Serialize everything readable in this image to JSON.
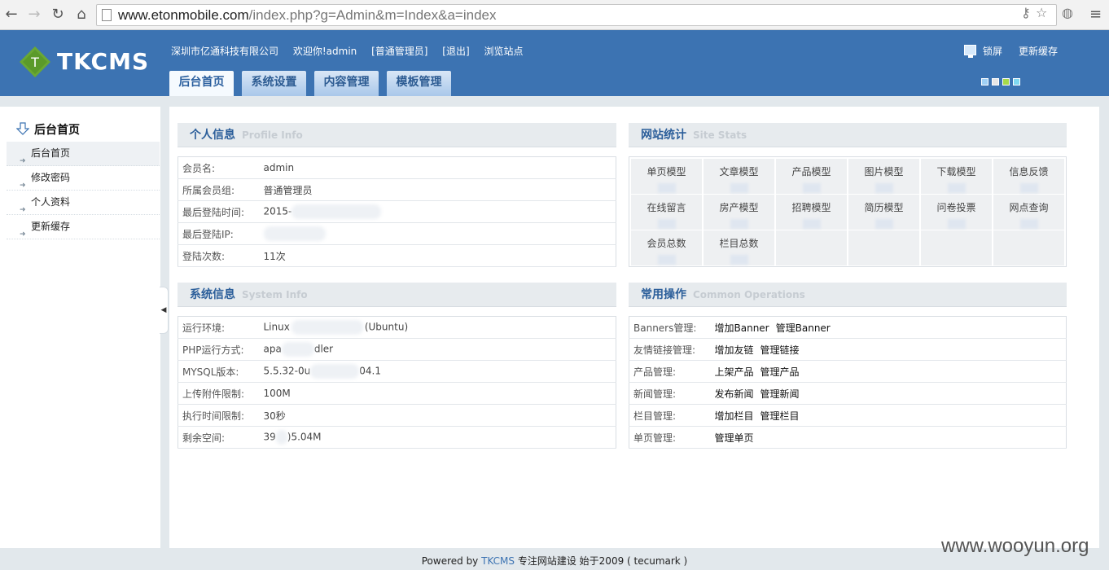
{
  "browser": {
    "url_host": "www.etonmobile.com",
    "url_path": "/index.php?g=Admin&m=Index&a=index"
  },
  "header": {
    "logo_text": "TKCMS",
    "company": "深圳市亿通科技有限公司",
    "welcome": "欢迎你!",
    "username": "admin",
    "role": "[普通管理员]",
    "logout": "[退出]",
    "browse_site": "浏览站点",
    "lock_screen": "锁屏",
    "refresh_cache": "更新缓存",
    "tabs": [
      "后台首页",
      "系统设置",
      "内容管理",
      "模板管理"
    ],
    "skin_colors": [
      "#9fd0f5",
      "#e6e6e6",
      "#a5d94a",
      "#7fd8f0"
    ]
  },
  "sidebar": {
    "title": "后台首页",
    "items": [
      "后台首页",
      "修改密码",
      "个人资料",
      "更新缓存"
    ]
  },
  "profile": {
    "title": "个人信息",
    "title_en": "Profile  Info",
    "rows": [
      {
        "k": "会员名:",
        "v": "admin"
      },
      {
        "k": "所属会员组:",
        "v": "普通管理员"
      },
      {
        "k": "最后登陆时间:",
        "v": "2015-"
      },
      {
        "k": "最后登陆IP:",
        "v": ""
      },
      {
        "k": "登陆次数:",
        "v": "11次"
      }
    ]
  },
  "site_stats": {
    "title": "网站统计",
    "title_en": "Site  Stats",
    "items": [
      "单页模型",
      "文章模型",
      "产品模型",
      "图片模型",
      "下载模型",
      "信息反馈",
      "在线留言",
      "房产模型",
      "招聘模型",
      "简历模型",
      "问卷投票",
      "网点查询",
      "会员总数",
      "栏目总数"
    ]
  },
  "system": {
    "title": "系统信息",
    "title_en": "System  Info",
    "rows": [
      {
        "k": "运行环境:",
        "v": "Linux",
        "v2": "(Ubuntu)"
      },
      {
        "k": "PHP运行方式:",
        "v": "apa",
        "v2": "dler"
      },
      {
        "k": "MYSQL版本:",
        "v": "5.5.32-0u",
        "v2": "04.1"
      },
      {
        "k": "上传附件限制:",
        "v": "100M",
        "v2": ""
      },
      {
        "k": "执行时间限制:",
        "v": "30秒",
        "v2": ""
      },
      {
        "k": "剩余空间:",
        "v": "39",
        "v2": ")5.04M"
      }
    ]
  },
  "ops": {
    "title": "常用操作",
    "title_en": "Common  Operations",
    "rows": [
      {
        "k": "Banners管理:",
        "a": "增加Banner",
        "b": "管理Banner"
      },
      {
        "k": "友情链接管理:",
        "a": "增加友链",
        "b": "管理链接"
      },
      {
        "k": "产品管理:",
        "a": "上架产品",
        "b": "管理产品"
      },
      {
        "k": "新闻管理:",
        "a": "发布新闻",
        "b": "管理新闻"
      },
      {
        "k": "栏目管理:",
        "a": "增加栏目",
        "b": "管理栏目"
      },
      {
        "k": "单页管理:",
        "a": "管理单页",
        "b": ""
      }
    ]
  },
  "footer": {
    "powered": "Powered by",
    "brand": "TKCMS",
    "slogan": "专注网站建设  始于2009 ( tecumark )"
  },
  "watermark": "www.wooyun.org"
}
